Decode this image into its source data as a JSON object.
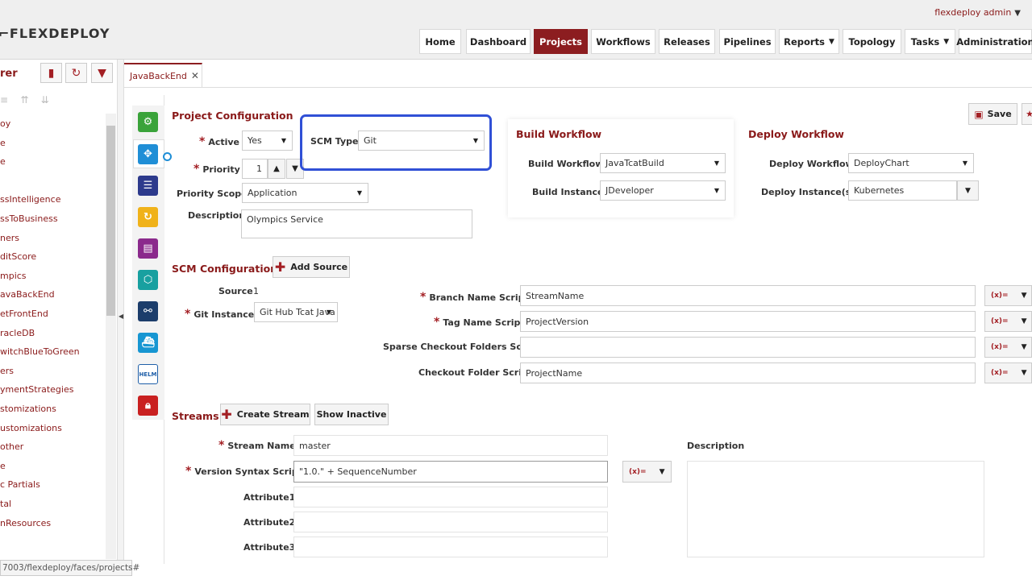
{
  "header": {
    "logo": "FlexDeploy",
    "user": "flexdeploy admin",
    "nav": [
      "Home",
      "Dashboard",
      "Projects",
      "Workflows",
      "Releases",
      "Pipelines",
      "Reports",
      "Topology",
      "Tasks",
      "Administration"
    ]
  },
  "explorer": {
    "title": "rer",
    "items": [
      "oy",
      "e",
      "e",
      "",
      "ssIntelligence",
      "ssToBusiness",
      "ners",
      "ditScore",
      "mpics",
      "avaBackEnd",
      "etFrontEnd",
      "racleDB",
      "witchBlueToGreen",
      "ers",
      "ymentStrategies",
      "stomizations",
      "ustomizations",
      "other",
      "e",
      "c Partials",
      "tal",
      "nResources"
    ]
  },
  "tab": {
    "label": "JavaBackEnd"
  },
  "project": {
    "title": "Project Configuration",
    "active_label": "Active",
    "active_value": "Yes",
    "scm_type_label": "SCM Type",
    "scm_type_value": "Git",
    "priority_label": "Priority",
    "priority_value": "1",
    "priority_scope_label": "Priority Scope",
    "priority_scope_value": "Application",
    "description_label": "Description",
    "description_value": "Olympics Service"
  },
  "build": {
    "title": "Build Workflow",
    "workflow_label": "Build Workflow",
    "workflow_value": "JavaTcatBuild",
    "instance_label": "Build Instance",
    "instance_value": "JDeveloper"
  },
  "deploy": {
    "title": "Deploy Workflow",
    "workflow_label": "Deploy Workflow",
    "workflow_value": "DeployChart",
    "instances_label": "Deploy Instance(s)",
    "instances_value": "Kubernetes"
  },
  "save_label": "Save",
  "scm": {
    "title": "SCM Configuration",
    "add_source": "Add Source",
    "source_label": "Source",
    "source_value": "1",
    "git_instance_label": "Git Instance",
    "git_instance_value": "Git Hub Tcat Java",
    "branch_label": "Branch Name Script",
    "branch_value": "StreamName",
    "tag_label": "Tag Name Script",
    "tag_value": "ProjectVersion",
    "sparse_label": "Sparse Checkout Folders Script",
    "sparse_value": "",
    "checkout_label": "Checkout Folder Script",
    "checkout_value": "ProjectName",
    "fx_label": "(x)="
  },
  "streams": {
    "title": "Streams",
    "create": "Create Stream",
    "show_inactive": "Show Inactive",
    "name_label": "Stream Name",
    "name_value": "master",
    "version_label": "Version Syntax Script",
    "version_value": "\"1.0.\" + SequenceNumber",
    "attr1": "Attribute1",
    "attr2": "Attribute2",
    "attr3": "Attribute3",
    "description_label": "Description"
  },
  "status": {
    "url": "7003/flexdeploy/faces/projects#"
  }
}
